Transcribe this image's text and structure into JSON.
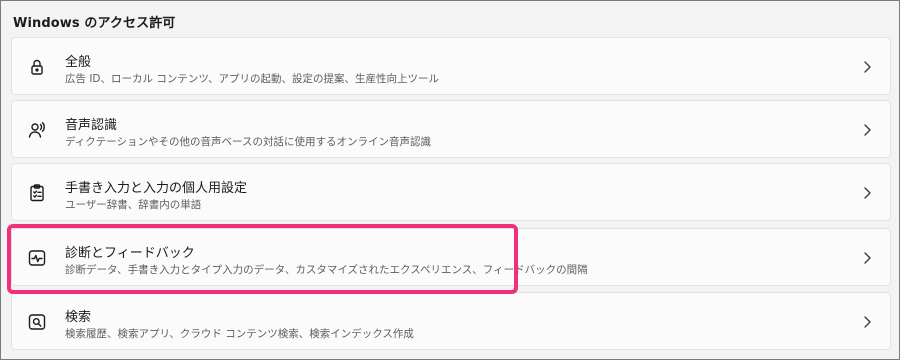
{
  "section": {
    "title": "Windows のアクセス許可"
  },
  "items": [
    {
      "icon": "lock-icon",
      "title": "全般",
      "subtitle": "広告 ID、ローカル コンテンツ、アプリの起動、設定の提案、生産性向上ツール"
    },
    {
      "icon": "voice-person-icon",
      "title": "音声認識",
      "subtitle": "ディクテーションやその他の音声ベースの対話に使用するオンライン音声認識"
    },
    {
      "icon": "clipboard-checklist-icon",
      "title": "手書き入力と入力の個人用設定",
      "subtitle": "ユーザー辞書、辞書内の単語"
    },
    {
      "icon": "activity-pulse-icon",
      "title": "診断とフィードバック",
      "subtitle": "診断データ、手書き入力とタイプ入力のデータ、カスタマイズされたエクスペリエンス、フィードバックの間隔"
    },
    {
      "icon": "search-icon",
      "title": "検索",
      "subtitle": "検索履歴、検索アプリ、クラウド コンテンツ検索、検索インデックス作成"
    }
  ],
  "colors": {
    "background": "#f3f3f3",
    "card": "#fbfbfb",
    "card_border": "#e3e3e3",
    "highlight": "#f0307a"
  }
}
